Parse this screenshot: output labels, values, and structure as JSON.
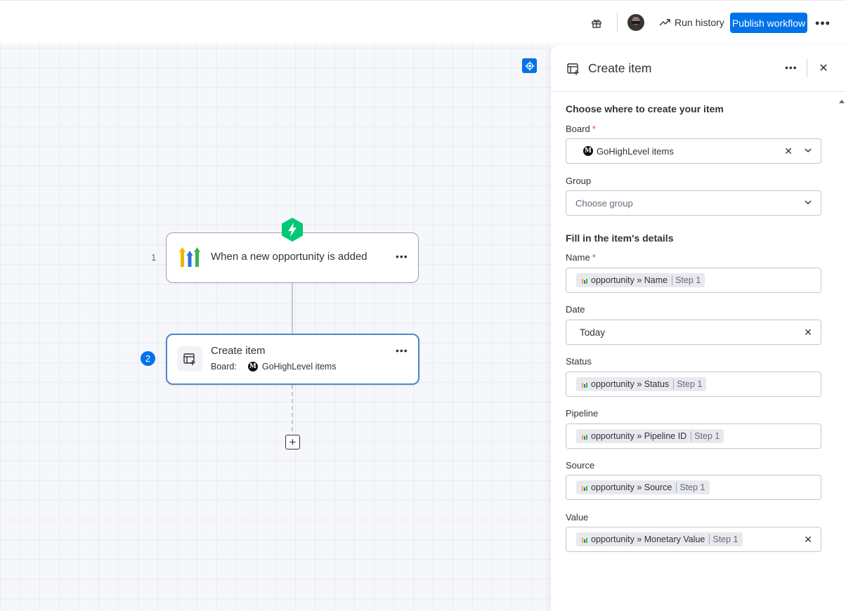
{
  "topbar": {
    "run_history_label": "Run history",
    "publish_label": "Publish workflow"
  },
  "colors": {
    "accent": "#0073ea",
    "trigger_green": "#00c875",
    "required": "#e2445c"
  },
  "canvas": {
    "steps": [
      {
        "number": "1",
        "title": "When a new opportunity is added",
        "icon": "gohighlevel-logo-icon"
      },
      {
        "number": "2",
        "title": "Create item",
        "board_label": "Board:",
        "board_value": "GoHighLevel items",
        "icon": "create-item-icon"
      }
    ]
  },
  "panel": {
    "title": "Create item",
    "section1_title": "Choose where to create your item",
    "board": {
      "label": "Board",
      "value": "GoHighLevel items"
    },
    "group": {
      "label": "Group",
      "placeholder": "Choose group"
    },
    "section2_title": "Fill in the item's details",
    "fields": {
      "name": {
        "label": "Name",
        "chip": "opportunity » Name",
        "step": "Step 1"
      },
      "date": {
        "label": "Date",
        "value": "Today"
      },
      "status": {
        "label": "Status",
        "chip": "opportunity » Status",
        "step": "Step 1"
      },
      "pipeline": {
        "label": "Pipeline",
        "chip": "opportunity » Pipeline ID",
        "step": "Step 1"
      },
      "source": {
        "label": "Source",
        "chip": "opportunity » Source",
        "step": "Step 1"
      },
      "value": {
        "label": "Value",
        "chip": "opportunity » Monetary Value",
        "step": "Step 1"
      }
    }
  }
}
